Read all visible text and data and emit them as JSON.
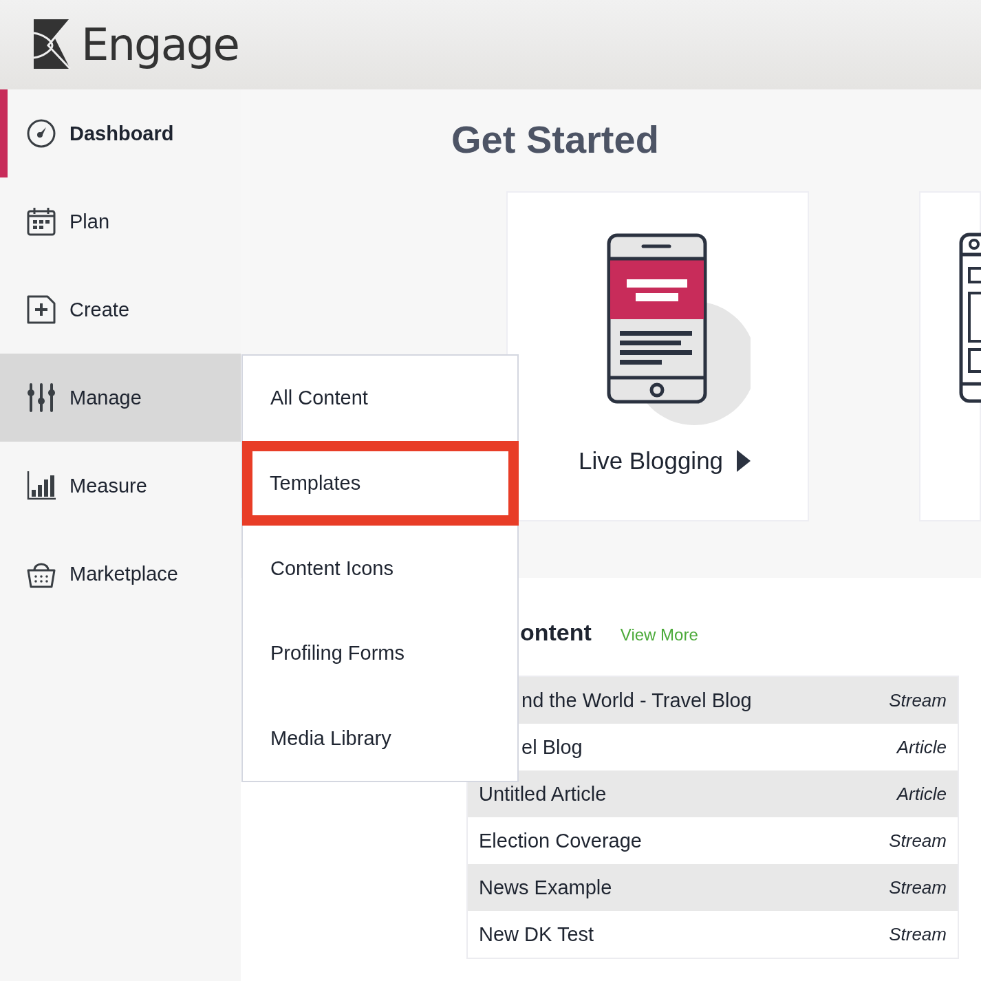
{
  "header": {
    "logo_text": "Engage"
  },
  "sidebar": {
    "items": [
      {
        "kind": "gauge",
        "label": "Dashboard",
        "selected": true,
        "expanded": false
      },
      {
        "kind": "calendar",
        "label": "Plan",
        "selected": false,
        "expanded": false
      },
      {
        "kind": "create",
        "label": "Create",
        "selected": false,
        "expanded": false
      },
      {
        "kind": "sliders",
        "label": "Manage",
        "selected": false,
        "expanded": true
      },
      {
        "kind": "chart",
        "label": "Measure",
        "selected": false,
        "expanded": false
      },
      {
        "kind": "basket",
        "label": "Marketplace",
        "selected": false,
        "expanded": false
      }
    ]
  },
  "submenu": {
    "items": [
      {
        "label": "All Content",
        "highlighted": false
      },
      {
        "label": "Templates",
        "highlighted": true
      },
      {
        "label": "Content Icons",
        "highlighted": false
      },
      {
        "label": "Profiling Forms",
        "highlighted": false
      },
      {
        "label": "Media Library",
        "highlighted": false
      }
    ]
  },
  "get_started": {
    "title": "Get Started",
    "cards": [
      {
        "kind": "live_blog",
        "label": "Live Blogging"
      },
      {
        "kind": "article"
      }
    ]
  },
  "recent_content": {
    "heading": "ontent",
    "link": "View More",
    "rows": [
      {
        "title": "nd the World - Travel Blog",
        "type": "Stream",
        "obscured": true
      },
      {
        "title": "el Blog",
        "type": "Article",
        "obscured": true
      },
      {
        "title": "Untitled Article",
        "type": "Article",
        "obscured": false
      },
      {
        "title": "Election Coverage",
        "type": "Stream",
        "obscured": false
      },
      {
        "title": "News Example",
        "type": "Stream",
        "obscured": false
      },
      {
        "title": "New DK Test",
        "type": "Stream",
        "obscured": false
      }
    ]
  }
}
